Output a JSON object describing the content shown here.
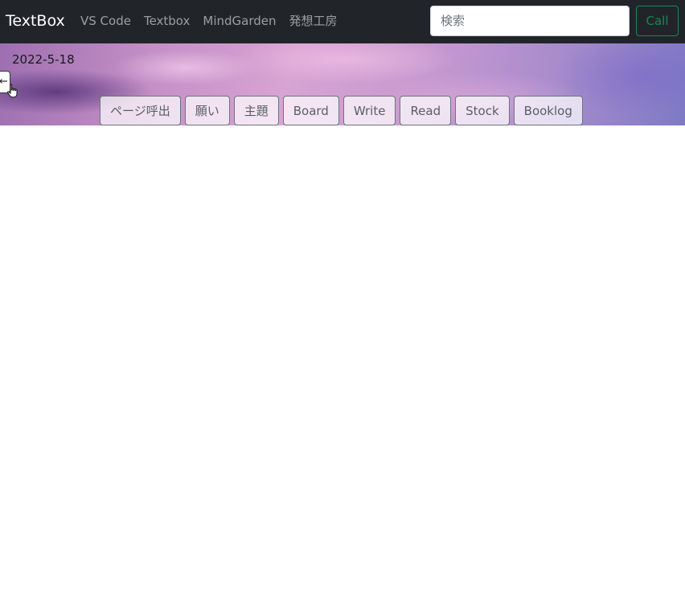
{
  "navbar": {
    "brand": "TextBox",
    "links": [
      {
        "label": "VS Code"
      },
      {
        "label": "Textbox"
      },
      {
        "label": "MindGarden"
      },
      {
        "label": "発想工房"
      }
    ],
    "search": {
      "placeholder": "検索",
      "value": ""
    },
    "call_label": "Call"
  },
  "hero": {
    "date": "2022-5-18",
    "toggle_icon": "arrow-left-icon",
    "tabs": [
      {
        "label": "ページ呼出"
      },
      {
        "label": "願い"
      },
      {
        "label": "主題"
      },
      {
        "label": "Board"
      },
      {
        "label": "Write"
      },
      {
        "label": "Read"
      },
      {
        "label": "Stock"
      },
      {
        "label": "Booklog"
      }
    ]
  },
  "colors": {
    "navbar_bg": "#212529",
    "call_accent": "#198754"
  }
}
